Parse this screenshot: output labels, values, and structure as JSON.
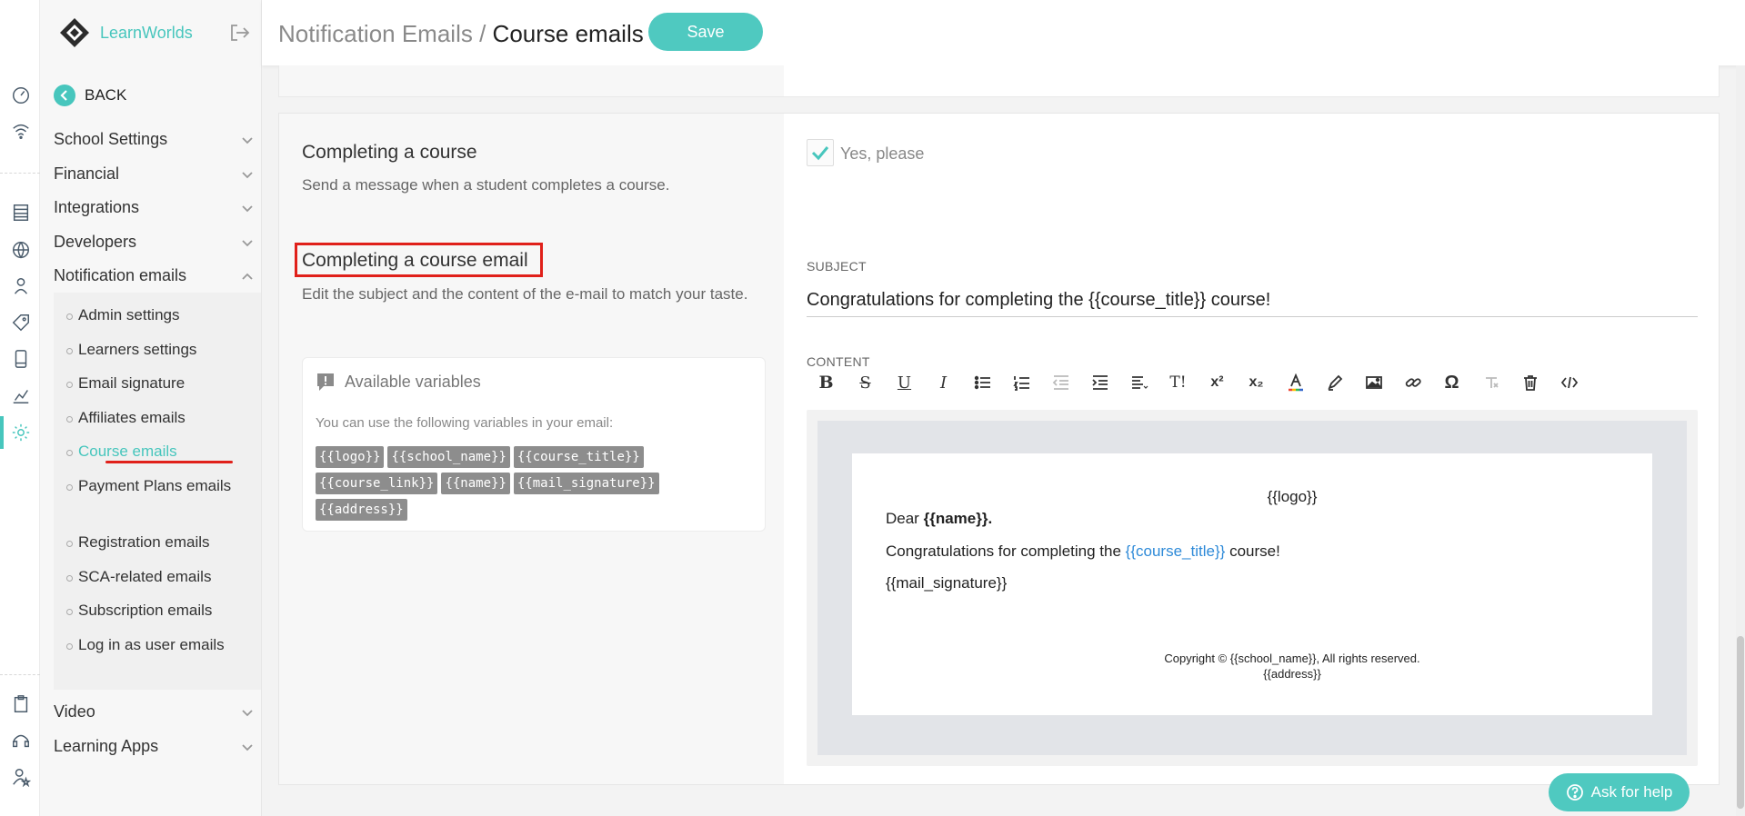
{
  "app": {
    "brand": "LearnWorlds",
    "accent": "#47c6bd",
    "highlight": "#e0201a"
  },
  "sidebar": {
    "back_label": "BACK",
    "items": [
      {
        "label": "School Settings",
        "state": "collapsed"
      },
      {
        "label": "Financial",
        "state": "collapsed"
      },
      {
        "label": "Integrations",
        "state": "collapsed"
      },
      {
        "label": "Developers",
        "state": "collapsed"
      },
      {
        "label": "Notification emails",
        "state": "expanded"
      },
      {
        "label": "Video",
        "state": "collapsed"
      },
      {
        "label": "Learning Apps",
        "state": "collapsed"
      }
    ],
    "sub_items": [
      {
        "label": "Admin settings"
      },
      {
        "label": "Learners settings"
      },
      {
        "label": "Email signature"
      },
      {
        "label": "Affiliates emails"
      },
      {
        "label": "Course emails",
        "active": true
      },
      {
        "label": "Payment Plans emails"
      },
      {
        "label": "Registration emails"
      },
      {
        "label": "SCA-related emails"
      },
      {
        "label": "Subscription emails"
      },
      {
        "label": "Log in as user emails"
      }
    ]
  },
  "header": {
    "breadcrumb_parent": "Notification Emails /",
    "breadcrumb_current": "Course emails",
    "save_label": "Save"
  },
  "section": {
    "title": "Completing a course",
    "description": "Send a message when a student completes a course.",
    "toggle_label": "Yes, please",
    "toggle_checked": true,
    "email_title": "Completing a course email",
    "email_description": "Edit the subject and the content of the e-mail to match your taste."
  },
  "variables": {
    "title": "Available variables",
    "note": "You can use the following variables in your email:",
    "tags": [
      "{{logo}}",
      "{{school_name}}",
      "{{course_title}}",
      "{{course_link}}",
      "{{name}}",
      "{{mail_signature}}",
      "{{address}}"
    ]
  },
  "subject": {
    "label": "SUBJECT",
    "value": "Congratulations for completing the {{course_title}} course!"
  },
  "content": {
    "label": "CONTENT",
    "toolbar": [
      "bold-icon",
      "strikethrough-icon",
      "underline-icon",
      "italic-icon",
      "bullet-list-icon",
      "numbered-list-icon",
      "outdent-icon",
      "indent-icon",
      "align-icon",
      "font-size-icon",
      "superscript-icon",
      "subscript-icon",
      "text-color-icon",
      "highlight-pen-icon",
      "image-icon",
      "link-icon",
      "special-char-icon",
      "clear-format-icon",
      "trash-icon",
      "code-view-icon"
    ],
    "toolbar_glyphs": {
      "font_size": "T!",
      "superscript": "x²",
      "subscript": "x₂",
      "special_char": "Ω"
    },
    "email": {
      "logo": "{{logo}}",
      "greeting_prefix": "Dear",
      "greeting_name": "{{name}}.",
      "body_prefix": "Congratulations for completing the",
      "body_link": "{{course_title}}",
      "body_suffix": "course!",
      "signature": "{{mail_signature}}",
      "footer_copyright": "Copyright © {{school_name}}, All rights reserved.",
      "footer_address": "{{address}}"
    }
  },
  "help": {
    "label": "Ask for help"
  }
}
